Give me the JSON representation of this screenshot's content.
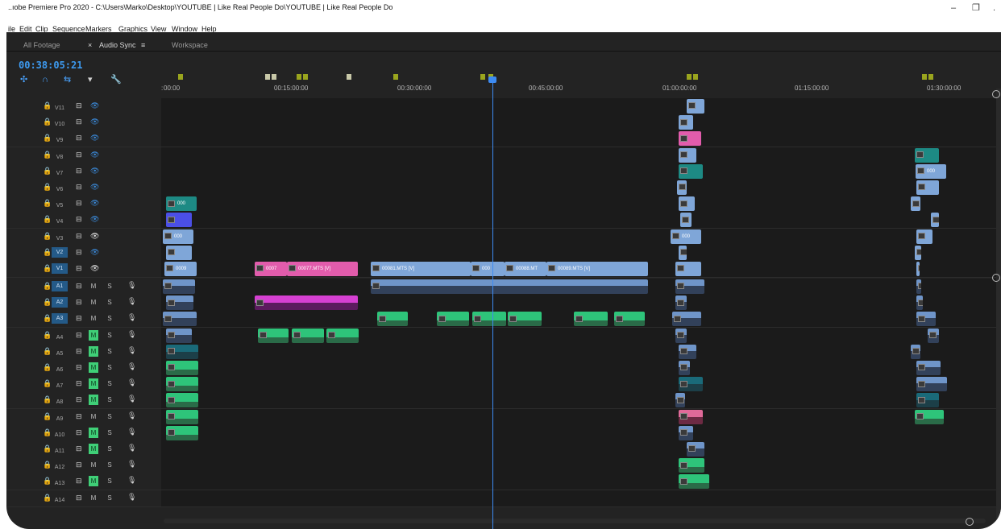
{
  "window": {
    "title": "..ıobe Premiere Pro 2020 - C:\\Users\\Marko\\Desktop\\YOUTUBE | Like Real People Do\\YOUTUBE | Like Real People Do",
    "minimize_glyph": "–",
    "restore_glyph": "❐",
    "close_glyph": "."
  },
  "menu": [
    "ile",
    "Edit",
    "Clip",
    "Sequence",
    "Markers",
    "Graphics",
    "View",
    "Window",
    "Help"
  ],
  "panel_tabs": {
    "footage": "All Footage",
    "sync_close": "×",
    "sync": "Audio Sync",
    "sync_menu": "≡",
    "workspace": "Workspace"
  },
  "timecode": "00:38:05:21",
  "tools": {
    "nest": "✣",
    "snap": "∩",
    "linked": "⇆",
    "marker": "▾",
    "wrench": "🔧"
  },
  "ruler_labels": [
    "00:00",
    "00:15:00:00",
    "00:30:00:00",
    "00:45:00:00",
    "01:00:00:00",
    "01:15:00:00",
    "01:30:00:00"
  ],
  "ruler_label_prefix": ":",
  "video_tracks": [
    {
      "name": "V11",
      "eye": "off",
      "selected": false
    },
    {
      "name": "V10",
      "eye": "off",
      "selected": false
    },
    {
      "name": "V9",
      "eye": "off",
      "selected": false
    },
    {
      "name": "V8",
      "eye": "off",
      "selected": false
    },
    {
      "name": "V7",
      "eye": "off",
      "selected": false
    },
    {
      "name": "V6",
      "eye": "off",
      "selected": false
    },
    {
      "name": "V5",
      "eye": "off",
      "selected": false
    },
    {
      "name": "V4",
      "eye": "off",
      "selected": false
    },
    {
      "name": "V3",
      "eye": "on",
      "selected": false
    },
    {
      "name": "V2",
      "eye": "off",
      "selected": true
    },
    {
      "name": "V1",
      "eye": "on",
      "selected": true
    }
  ],
  "audio_tracks": [
    {
      "name": "A1",
      "mute": false,
      "selected": true
    },
    {
      "name": "A2",
      "mute": false,
      "selected": true
    },
    {
      "name": "A3",
      "mute": false,
      "selected": true
    },
    {
      "name": "A4",
      "mute": true,
      "selected": false
    },
    {
      "name": "A5",
      "mute": true,
      "selected": false
    },
    {
      "name": "A6",
      "mute": true,
      "selected": false
    },
    {
      "name": "A7",
      "mute": true,
      "selected": false
    },
    {
      "name": "A8",
      "mute": true,
      "selected": false
    },
    {
      "name": "A9",
      "mute": false,
      "selected": false
    },
    {
      "name": "A10",
      "mute": true,
      "selected": false
    },
    {
      "name": "A11",
      "mute": true,
      "selected": false
    },
    {
      "name": "A12",
      "mute": false,
      "selected": false
    },
    {
      "name": "A13",
      "mute": true,
      "selected": false
    },
    {
      "name": "A14",
      "mute": false,
      "selected": false
    }
  ],
  "track_glyphs": {
    "lock": "🔒",
    "sync": "⊟",
    "eye": "👁",
    "mute": "M",
    "solo": "S",
    "mic": "🎙"
  },
  "clip_labels": {
    "v5_a": "000",
    "v3_a": "000",
    "v1_a": "0009",
    "v1_b": "0007",
    "v1_c": "00077.MTS [V]",
    "v1_d": "00081.MTS [V]",
    "v1_e": "000",
    "v1_f": "00088.MT",
    "v1_g": "00089.MTS [V]",
    "v7_b": "000",
    "v3_b": "000"
  },
  "colors": {
    "playhead": "#3d8bf2",
    "work_area": "#e3d21a",
    "mute_on": "#3fcf77",
    "selected_track": "#245a88"
  }
}
